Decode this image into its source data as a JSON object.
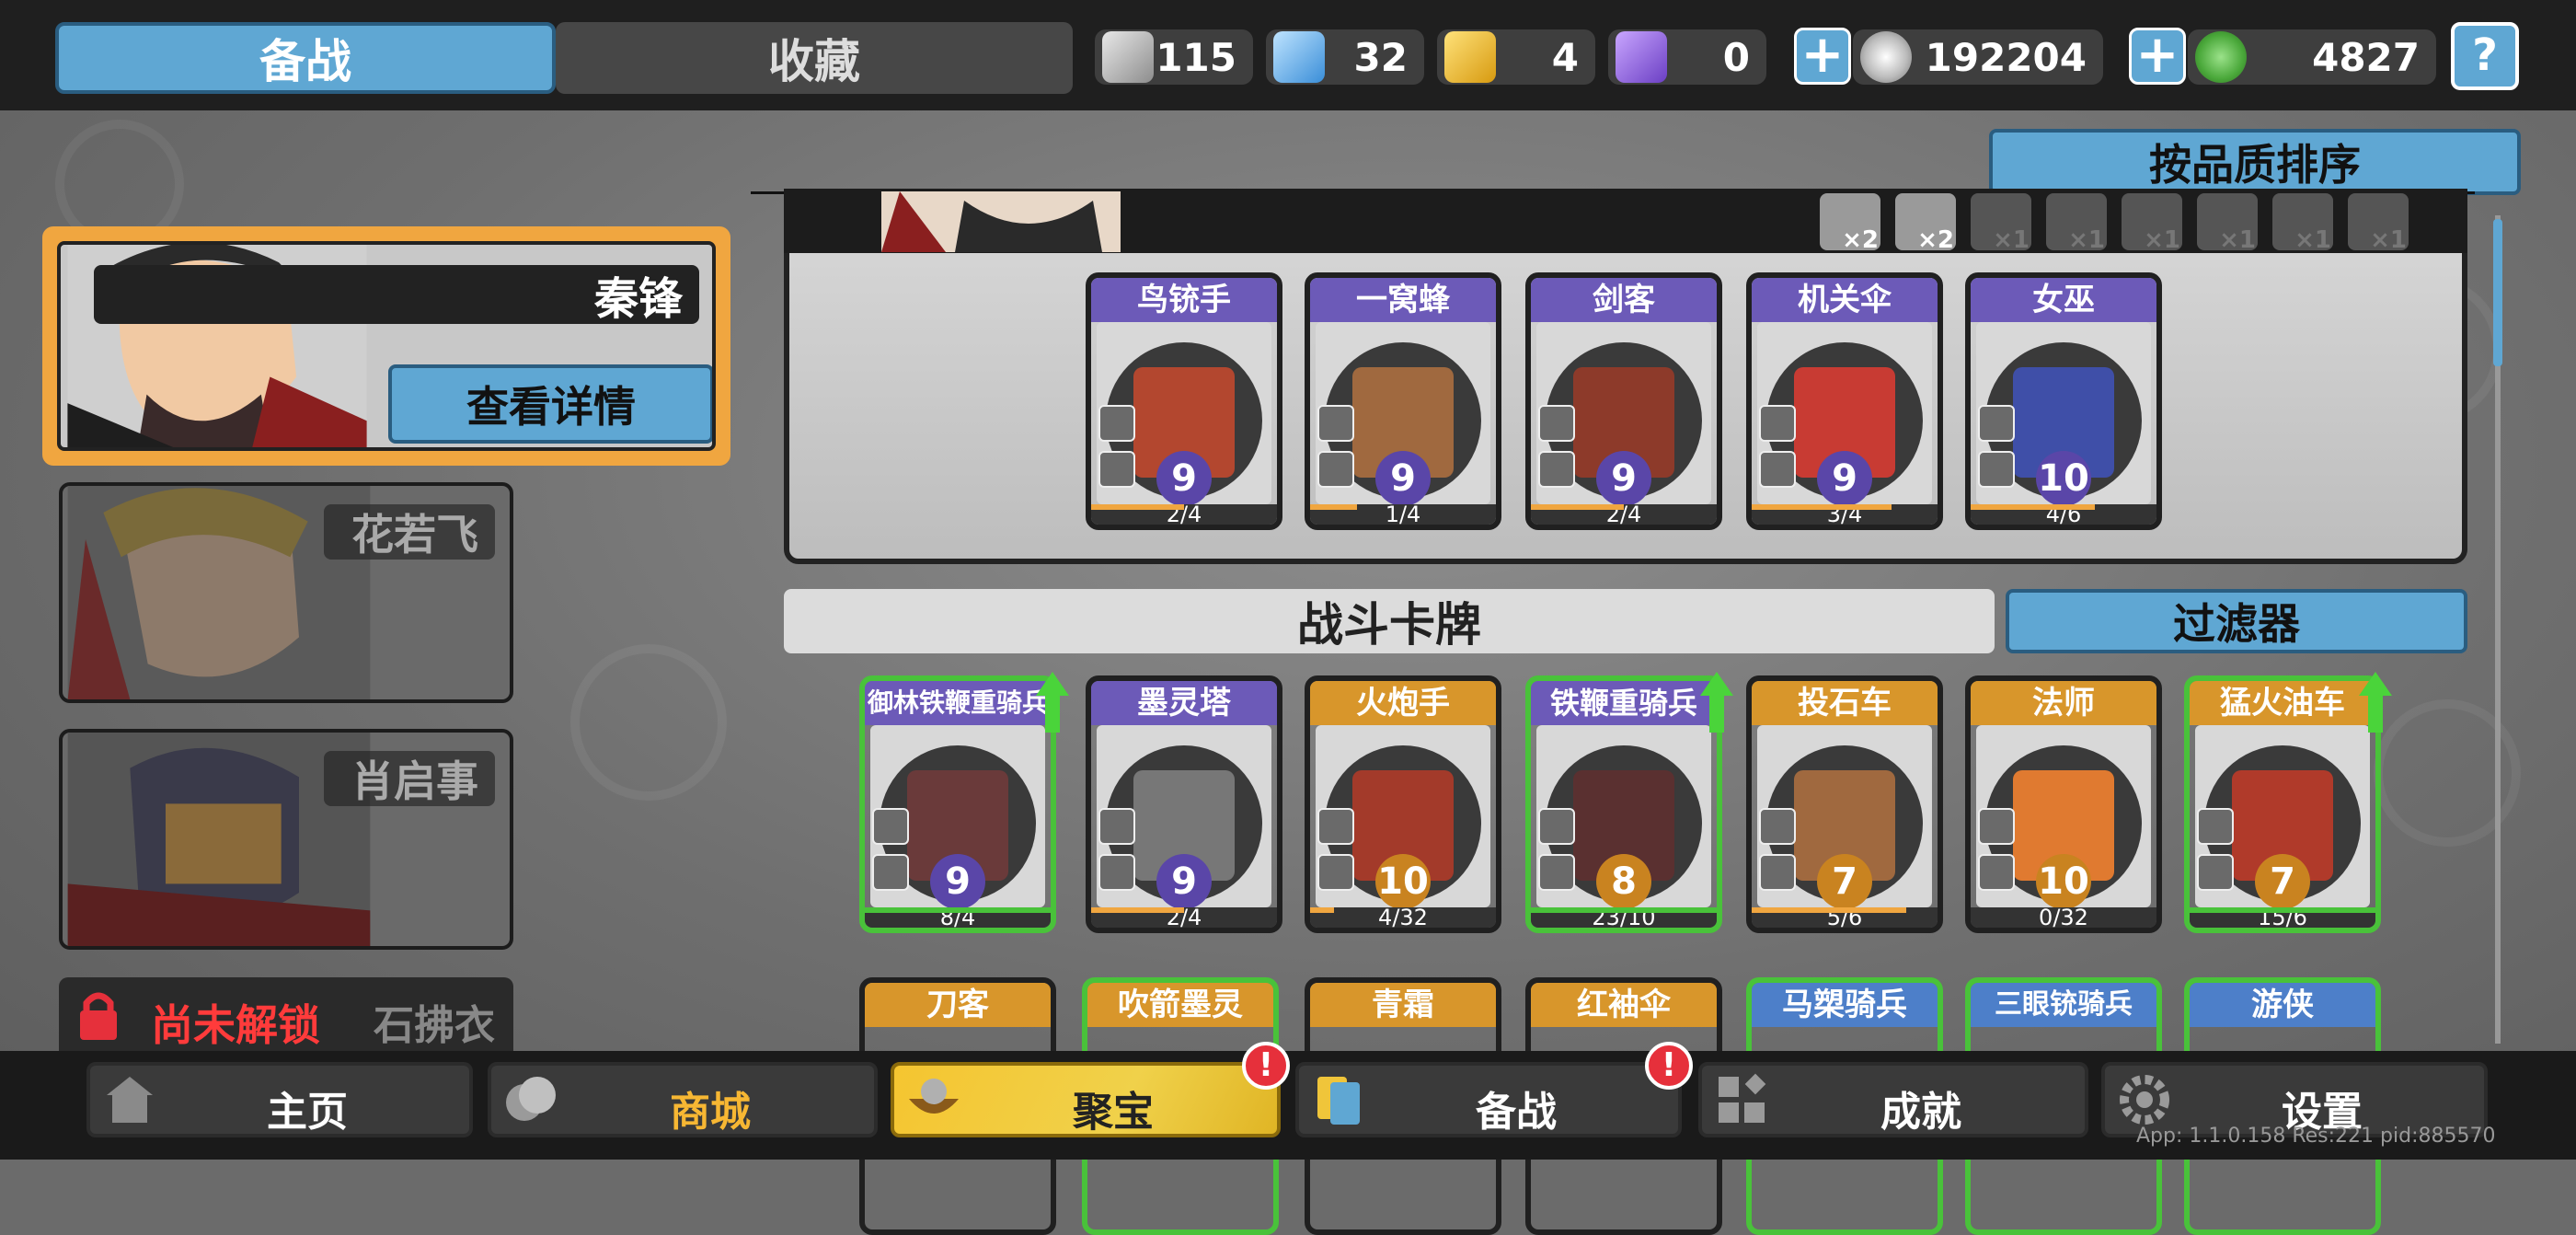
{
  "tabs": {
    "active": "备战",
    "inactive": "收藏"
  },
  "resources": [
    {
      "icon": "silver-shard-icon",
      "value": "115"
    },
    {
      "icon": "blue-crystal-icon",
      "value": "32"
    },
    {
      "icon": "gold-shield-icon",
      "value": "4"
    },
    {
      "icon": "purple-gem-icon",
      "value": "0"
    },
    {
      "icon": "silver-coin-icon",
      "value": "192204"
    },
    {
      "icon": "jade-coin-icon",
      "value": "4827"
    }
  ],
  "help_label": "?",
  "sort_button": "按品质排序",
  "heroes": [
    {
      "name": "秦锋",
      "detail_button": "查看详情"
    },
    {
      "name": "花若飞"
    },
    {
      "name": "肖启事"
    },
    {
      "name": "石拂衣",
      "locked_text": "尚未解锁"
    }
  ],
  "equipment_slots": [
    {
      "icon": "sword-rack-icon",
      "count": "×2"
    },
    {
      "icon": "umbrella-icon",
      "count": "×2"
    },
    {
      "icon": "helmet-icon",
      "count": "×1"
    },
    {
      "icon": "warrior-icon",
      "count": "×1"
    },
    {
      "icon": "gear-icon",
      "count": "×1"
    },
    {
      "icon": "sun-icon",
      "count": "×1"
    },
    {
      "icon": "blade-icon",
      "count": "×1"
    },
    {
      "icon": "shield-icon",
      "count": "×1"
    }
  ],
  "deck_cards": [
    {
      "name": "鸟铳手",
      "level": "9",
      "progress": "2/4",
      "fill": 0.5
    },
    {
      "name": "一窝蜂",
      "level": "9",
      "progress": "1/4",
      "fill": 0.25
    },
    {
      "name": "剑客",
      "level": "9",
      "progress": "2/4",
      "fill": 0.5
    },
    {
      "name": "机关伞",
      "level": "9",
      "progress": "3/4",
      "fill": 0.75
    },
    {
      "name": "女巫",
      "level": "10",
      "progress": "4/6",
      "fill": 0.67
    }
  ],
  "battle_header": "战斗卡牌",
  "filter_button": "过滤器",
  "battle_cards": [
    {
      "name": "御林铁鞭重骑兵",
      "level": "9",
      "progress": "8/4",
      "fill": 1.0
    },
    {
      "name": "墨灵塔",
      "level": "9",
      "progress": "2/4",
      "fill": 0.5
    },
    {
      "name": "火炮手",
      "level": "10",
      "progress": "4/32",
      "fill": 0.13
    },
    {
      "name": "铁鞭重骑兵",
      "level": "8",
      "progress": "23/10",
      "fill": 1.0
    },
    {
      "name": "投石车",
      "level": "7",
      "progress": "5/6",
      "fill": 0.83
    },
    {
      "name": "法师",
      "level": "10",
      "progress": "0/32",
      "fill": 0.0
    },
    {
      "name": "猛火油车",
      "level": "7",
      "progress": "15/6",
      "fill": 1.0
    }
  ],
  "battle_cards_row2": [
    "刀客",
    "吹箭墨灵",
    "青霜",
    "红袖伞",
    "马槊骑兵",
    "三眼铳骑兵",
    "游侠"
  ],
  "nav": [
    {
      "label": "主页",
      "icon": "home-icon"
    },
    {
      "label": "商城",
      "icon": "coins-icon"
    },
    {
      "label": "聚宝",
      "icon": "treasure-bowl-icon",
      "badge": "!"
    },
    {
      "label": "备战",
      "icon": "cards-icon",
      "badge": "!"
    },
    {
      "label": "成就",
      "icon": "achievement-icon"
    },
    {
      "label": "设置",
      "icon": "gear-icon"
    }
  ],
  "version": "App: 1.1.0.158 Res:221 pid:885570",
  "colors": {
    "accent": "#5fa7d3",
    "select": "#f0a640",
    "purple_card": "#6c5ab8",
    "orange_card": "#d8962b",
    "green_upgrade": "#49c23a"
  }
}
